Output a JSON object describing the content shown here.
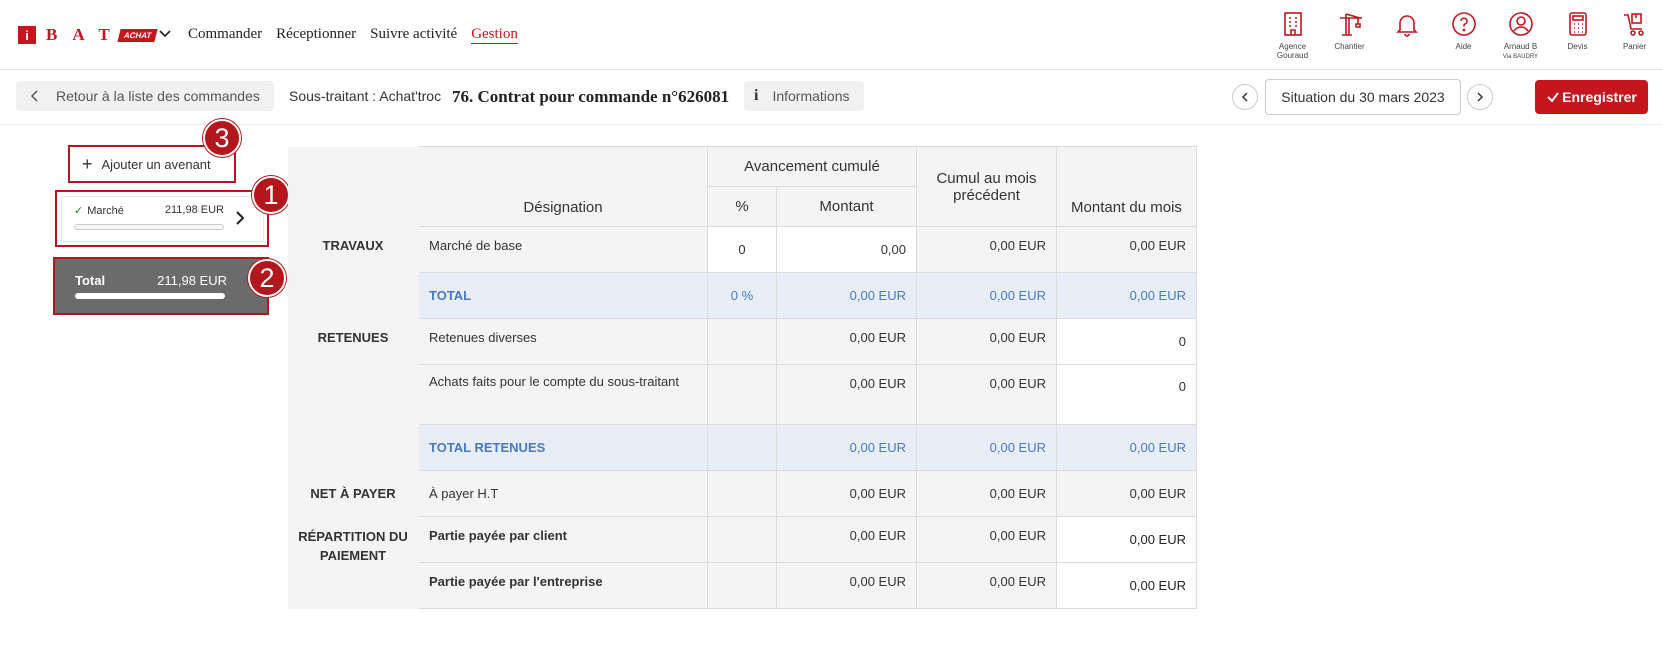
{
  "brand": {
    "name": "BAT",
    "tag": "ACHAT",
    "mark": "i"
  },
  "nav": {
    "menu": [
      "Commander",
      "Réceptionner",
      "Suivre activité",
      "Gestion"
    ],
    "active": "Gestion"
  },
  "tools": [
    {
      "icon": "building-icon",
      "label": "Agence",
      "sub": "Gouraud"
    },
    {
      "icon": "crane-icon",
      "label": "Chantier",
      "sub": ""
    },
    {
      "icon": "bell-icon",
      "label": "",
      "sub": ""
    },
    {
      "icon": "help-icon",
      "label": "Aide",
      "sub": ""
    },
    {
      "icon": "user-icon",
      "label": "Arnaud B",
      "sub": "Via BAUDRY"
    },
    {
      "icon": "calculator-icon",
      "label": "Devis",
      "sub": ""
    },
    {
      "icon": "cart-icon",
      "label": "Panier",
      "sub": ""
    }
  ],
  "subbar": {
    "back_label": "Retour à la liste des commandes",
    "subcontractor": "Sous-traitant : Achat'troc",
    "contract_title": "76. Contrat pour commande n°626081",
    "info_label": "Informations",
    "situation_label": "Situation du 30 mars 2023",
    "save_label": "Enregistrer"
  },
  "sidebar": {
    "add_label": "Ajouter un avenant",
    "marche": {
      "label": "Marché",
      "amount": "211,98 EUR",
      "progress": 0
    },
    "total": {
      "label": "Total",
      "amount": "211,98 EUR",
      "progress": 1
    }
  },
  "badges": [
    "1",
    "2",
    "3"
  ],
  "table": {
    "headers": {
      "designation": "Désignation",
      "avancement": "Avancement cumulé",
      "pct": "%",
      "montant": "Montant",
      "cumul": "Cumul au mois précédent",
      "mois": "Montant du mois"
    },
    "sections": {
      "travaux": "TRAVAUX",
      "retenues": "RETENUES",
      "net": "NET À PAYER",
      "repartition": "RÉPARTITION DU PAIEMENT"
    },
    "rows": {
      "marche_base": {
        "label": "Marché de base",
        "pct": "0",
        "montant": "0,00",
        "cumul": "0,00 EUR",
        "mois": "0,00 EUR"
      },
      "total": {
        "label": "TOTAL",
        "pct": "0 %",
        "montant": "0,00 EUR",
        "cumul": "0,00 EUR",
        "mois": "0,00 EUR"
      },
      "retenues_diverses": {
        "label": "Retenues diverses",
        "montant": "0,00 EUR",
        "cumul": "0,00 EUR",
        "mois": "0"
      },
      "achats": {
        "label": "Achats faits pour le compte du sous-traitant",
        "montant": "0,00 EUR",
        "cumul": "0,00 EUR",
        "mois": "0"
      },
      "total_retenues": {
        "label": "TOTAL RETENUES",
        "montant": "0,00 EUR",
        "cumul": "0,00 EUR",
        "mois": "0,00 EUR"
      },
      "a_payer": {
        "label": "À payer H.T",
        "montant": "0,00 EUR",
        "cumul": "0,00 EUR",
        "mois": "0,00 EUR"
      },
      "client": {
        "label": "Partie payée par client",
        "montant": "0,00 EUR",
        "cumul": "0,00 EUR",
        "mois": "0,00 EUR"
      },
      "entreprise": {
        "label": "Partie payée par l'entreprise",
        "montant": "0,00 EUR",
        "cumul": "0,00 EUR",
        "mois": "0,00 EUR"
      }
    }
  },
  "colors": {
    "brand": "#c4161c",
    "total_row_text": "#4a78c4",
    "total_row_bg": "#e8eef7"
  }
}
